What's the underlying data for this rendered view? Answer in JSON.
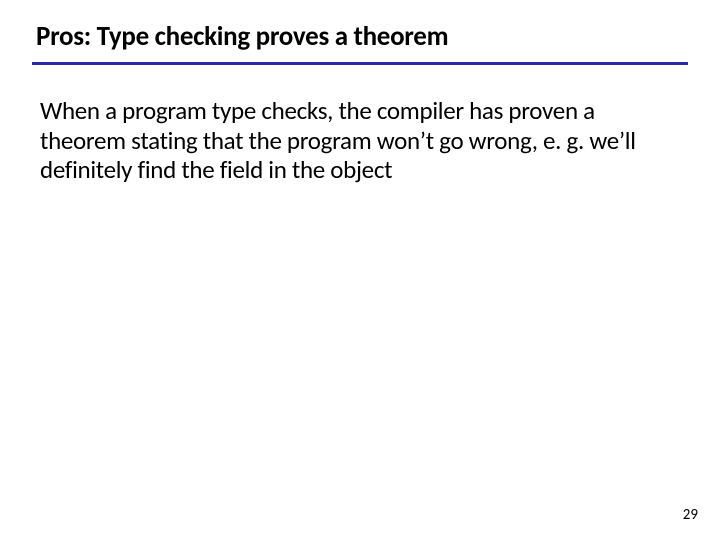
{
  "slide": {
    "title": "Pros: Type checking proves a theorem",
    "body": "When a program type checks, the compiler has proven a theorem stating that the program won’t go wrong, e. g. we’ll definitely find the field in the object",
    "page_number": "29",
    "rule_color": "#2a2aa8"
  }
}
